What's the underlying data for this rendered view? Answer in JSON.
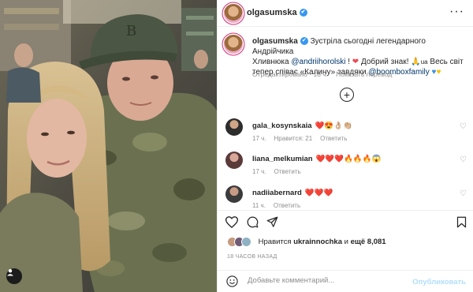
{
  "post": {
    "author": "olgasumska",
    "caption_author": "olgasumska",
    "caption_line1": "Зустріла сьогодні легендарного Андрійчика",
    "caption_line2a": "Хливнюка ",
    "caption_mention1": "@andriihorolski",
    "caption_line2b": " ! ",
    "caption_line2c": " Добрий знак! ",
    "caption_line2d": " Весь світ",
    "caption_line3a": "тепер співає «Калину» завдяки ",
    "caption_mention2": "@boomboxfamily",
    "edited_label": "Отредактировано · 18 ч.",
    "see_translation": "Показать перевод"
  },
  "comments": [
    {
      "user": "gala_kosynskaia",
      "emojis": "❤️😍👌🏼👏🏼",
      "time": "17 ч.",
      "likes": "Нравится: 21",
      "reply": "Ответить"
    },
    {
      "user": "liana_melkumian",
      "emojis": "❤️❤️❤️🔥🔥🔥😱",
      "time": "17 ч.",
      "reply": "Ответить"
    },
    {
      "user": "nadiiabernard",
      "emojis": "❤️❤️❤️",
      "time": "11 ч.",
      "reply": "Ответить"
    }
  ],
  "likes": {
    "prefix": "Нравится ",
    "user": "ukrainnochka",
    "middle": " и ",
    "count": "ещё 8,081"
  },
  "time_ago": "18 ЧАСОВ НАЗАД",
  "add_comment": {
    "placeholder": "Добавьте комментарий...",
    "publish": "Опубликовать"
  },
  "colors": {
    "accent": "#3897f0",
    "heart": "#ed4956",
    "link": "#00376b",
    "publish_disabled": "#b2dffc"
  }
}
